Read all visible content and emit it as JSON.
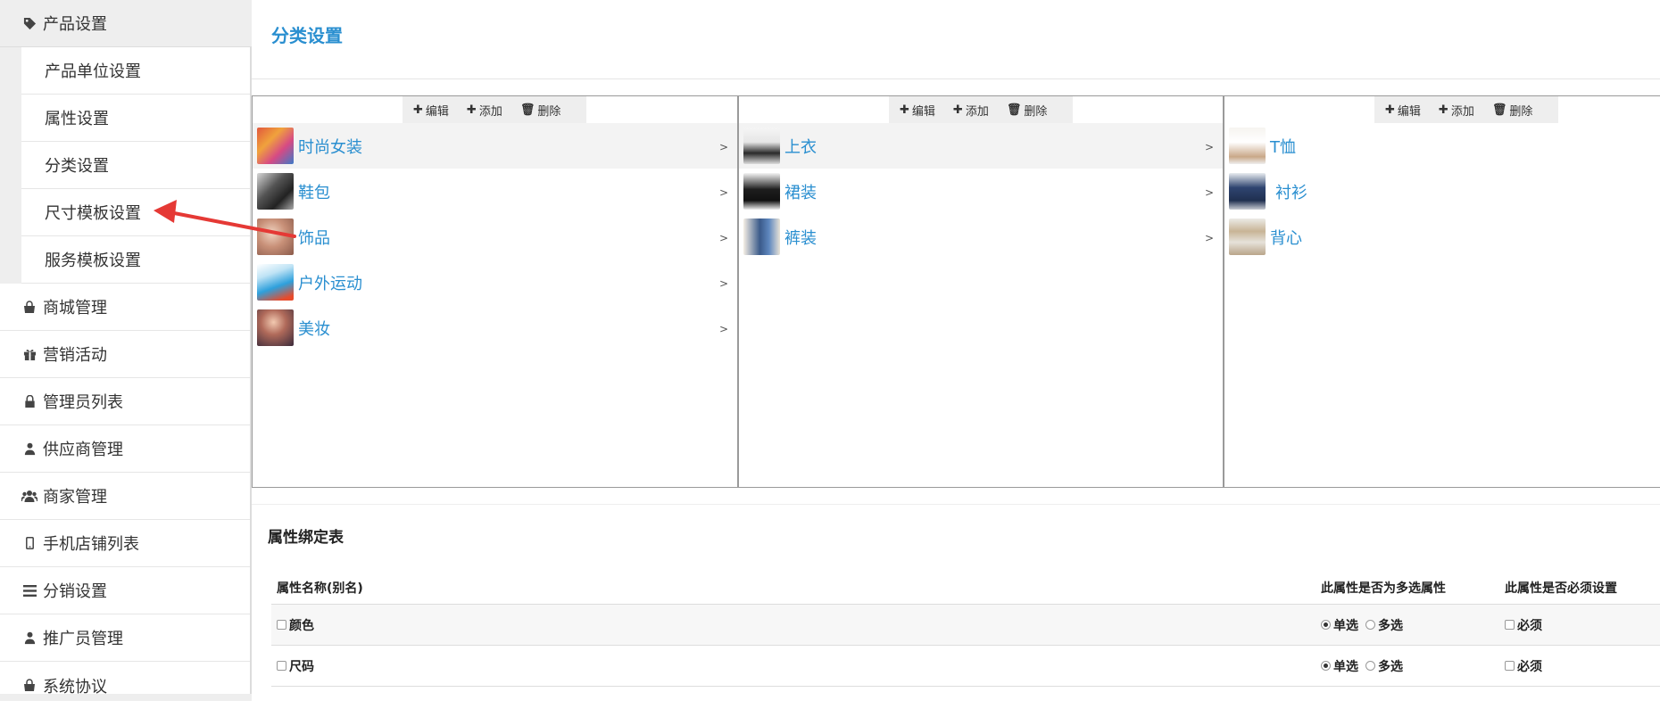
{
  "sidebar": {
    "top": {
      "label": "产品设置",
      "icon": "tag-icon"
    },
    "sub_items": [
      {
        "label": "产品单位设置"
      },
      {
        "label": "属性设置"
      },
      {
        "label": "分类设置"
      },
      {
        "label": "尺寸模板设置"
      },
      {
        "label": "服务模板设置"
      }
    ],
    "items": [
      {
        "label": "商城管理",
        "icon": "shop-bag-icon",
        "glyph": "▭"
      },
      {
        "label": "营销活动",
        "icon": "gift-icon",
        "glyph": "🎁"
      },
      {
        "label": "管理员列表",
        "icon": "lock-icon",
        "glyph": "🔒"
      },
      {
        "label": "供应商管理",
        "icon": "user-icon",
        "glyph": "♟"
      },
      {
        "label": "商家管理",
        "icon": "users-icon",
        "glyph": "👥"
      },
      {
        "label": "手机店铺列表",
        "icon": "mobile-icon",
        "glyph": "▯"
      },
      {
        "label": "分销设置",
        "icon": "list-icon",
        "glyph": "☰"
      },
      {
        "label": "推广员管理",
        "icon": "user-icon",
        "glyph": "♟"
      },
      {
        "label": "系统协议",
        "icon": "shop-bag-icon",
        "glyph": "▭"
      }
    ]
  },
  "main": {
    "title": "分类设置",
    "toolbar": {
      "edit": "编辑",
      "add": "添加",
      "delete": "删除"
    },
    "columns": [
      {
        "items": [
          {
            "name": "时尚女装",
            "thumb": "t1",
            "chev": ">"
          },
          {
            "name": "鞋包",
            "thumb": "t2",
            "chev": ">"
          },
          {
            "name": "饰品",
            "thumb": "t3",
            "chev": ">"
          },
          {
            "name": "户外运动",
            "thumb": "t4",
            "chev": ">"
          },
          {
            "name": "美妆",
            "thumb": "t5",
            "chev": ">"
          }
        ]
      },
      {
        "items": [
          {
            "name": "上衣",
            "thumb": "t6",
            "chev": ">"
          },
          {
            "name": "裙装",
            "thumb": "t7",
            "chev": ">"
          },
          {
            "name": "裤装",
            "thumb": "t8",
            "chev": ">"
          }
        ]
      },
      {
        "items": [
          {
            "name": "T恤",
            "thumb": "t9"
          },
          {
            "name": "衬衫",
            "thumb": "t10"
          },
          {
            "name": "背心",
            "thumb": "t11"
          }
        ]
      }
    ]
  },
  "attr_table": {
    "title": "属性绑定表",
    "headers": {
      "name": "属性名称(别名)",
      "multi": "此属性是否为多选属性",
      "required": "此属性是否必须设置"
    },
    "rows": [
      {
        "name": "颜色",
        "single": "单选",
        "multi": "多选",
        "required": "必须"
      },
      {
        "name": "尺码",
        "single": "单选",
        "multi": "多选",
        "required": "必须"
      }
    ]
  },
  "colors": {
    "accent": "#2a8fd0",
    "arrow": "#e53935"
  }
}
